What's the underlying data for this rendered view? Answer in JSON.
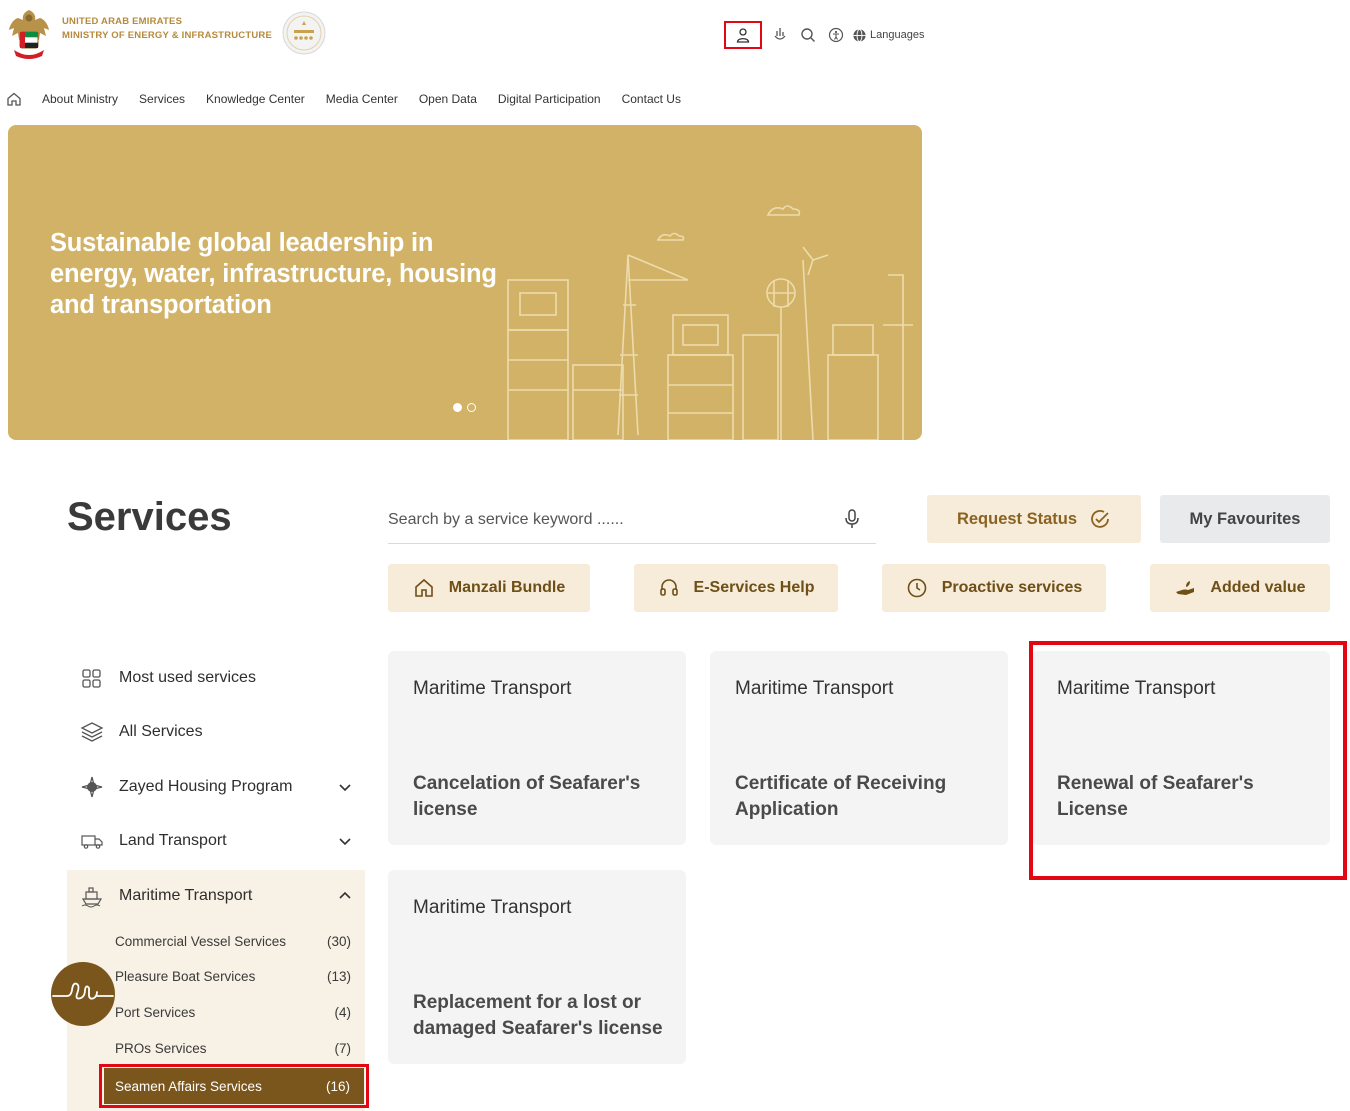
{
  "header": {
    "org_line1": "UNITED ARAB EMIRATES",
    "org_line2": "MINISTRY OF ENERGY & INFRASTRUCTURE",
    "emblem_icon": "uae-falcon-emblem",
    "rating_icon": "five-star-rating-seal",
    "utilities": {
      "user_icon": "user-icon",
      "accessibility_icon": "hand-sign-icon",
      "search_icon": "search-icon",
      "a11y_icon": "accessibility-icon",
      "languages_label": "Languages"
    }
  },
  "nav": {
    "home_icon": "home-icon",
    "items": [
      "About Ministry",
      "Services",
      "Knowledge Center",
      "Media Center",
      "Open Data",
      "Digital Participation",
      "Contact Us"
    ]
  },
  "hero": {
    "title": "Sustainable global leadership in energy, water, infrastructure, housing and transportation",
    "slides": 2,
    "active_slide": 1,
    "background": "#d2b266"
  },
  "services": {
    "title": "Services",
    "search_placeholder": "Search by a service keyword ......",
    "request_status": "Request Status",
    "my_favourites": "My Favourites",
    "pills": [
      {
        "label": "Manzali Bundle",
        "icon": "house-icon"
      },
      {
        "label": "E-Services Help",
        "icon": "headset-icon"
      },
      {
        "label": "Proactive services",
        "icon": "clock-icon"
      },
      {
        "label": "Added value",
        "icon": "hand-leaf-icon"
      }
    ]
  },
  "sidebar": {
    "items": [
      {
        "label": "Most used services",
        "icon": "grid-icon"
      },
      {
        "label": "All Services",
        "icon": "layers-icon"
      },
      {
        "label": "Zayed Housing Program",
        "icon": "compass-icon",
        "expanded": false
      },
      {
        "label": "Land Transport",
        "icon": "truck-icon",
        "expanded": false
      },
      {
        "label": "Maritime Transport",
        "icon": "ship-icon",
        "expanded": true
      }
    ],
    "sub_items": [
      {
        "label": "Commercial Vessel Services",
        "count": "(30)"
      },
      {
        "label": "Pleasure Boat Services",
        "count": "(13)"
      },
      {
        "label": "Port Services",
        "count": "(4)"
      },
      {
        "label": "PROs Services",
        "count": "(7)"
      },
      {
        "label": "Seamen Affairs Services",
        "count": "(16)",
        "active": true
      }
    ]
  },
  "cards": [
    {
      "category": "Maritime Transport",
      "title": "Cancelation of Seafarer's license"
    },
    {
      "category": "Maritime Transport",
      "title": "Certificate of Receiving Application"
    },
    {
      "category": "Maritime Transport",
      "title": "Renewal of Seafarer's License",
      "highlighted": true
    },
    {
      "category": "Maritime Transport",
      "title": "Replacement for a lost or damaged Seafarer's license"
    }
  ],
  "colors": {
    "accent_gold": "#b68a3d",
    "pill_bg": "#f7ecd9",
    "active_brown": "#7a561c",
    "highlight_red": "#e30613"
  }
}
